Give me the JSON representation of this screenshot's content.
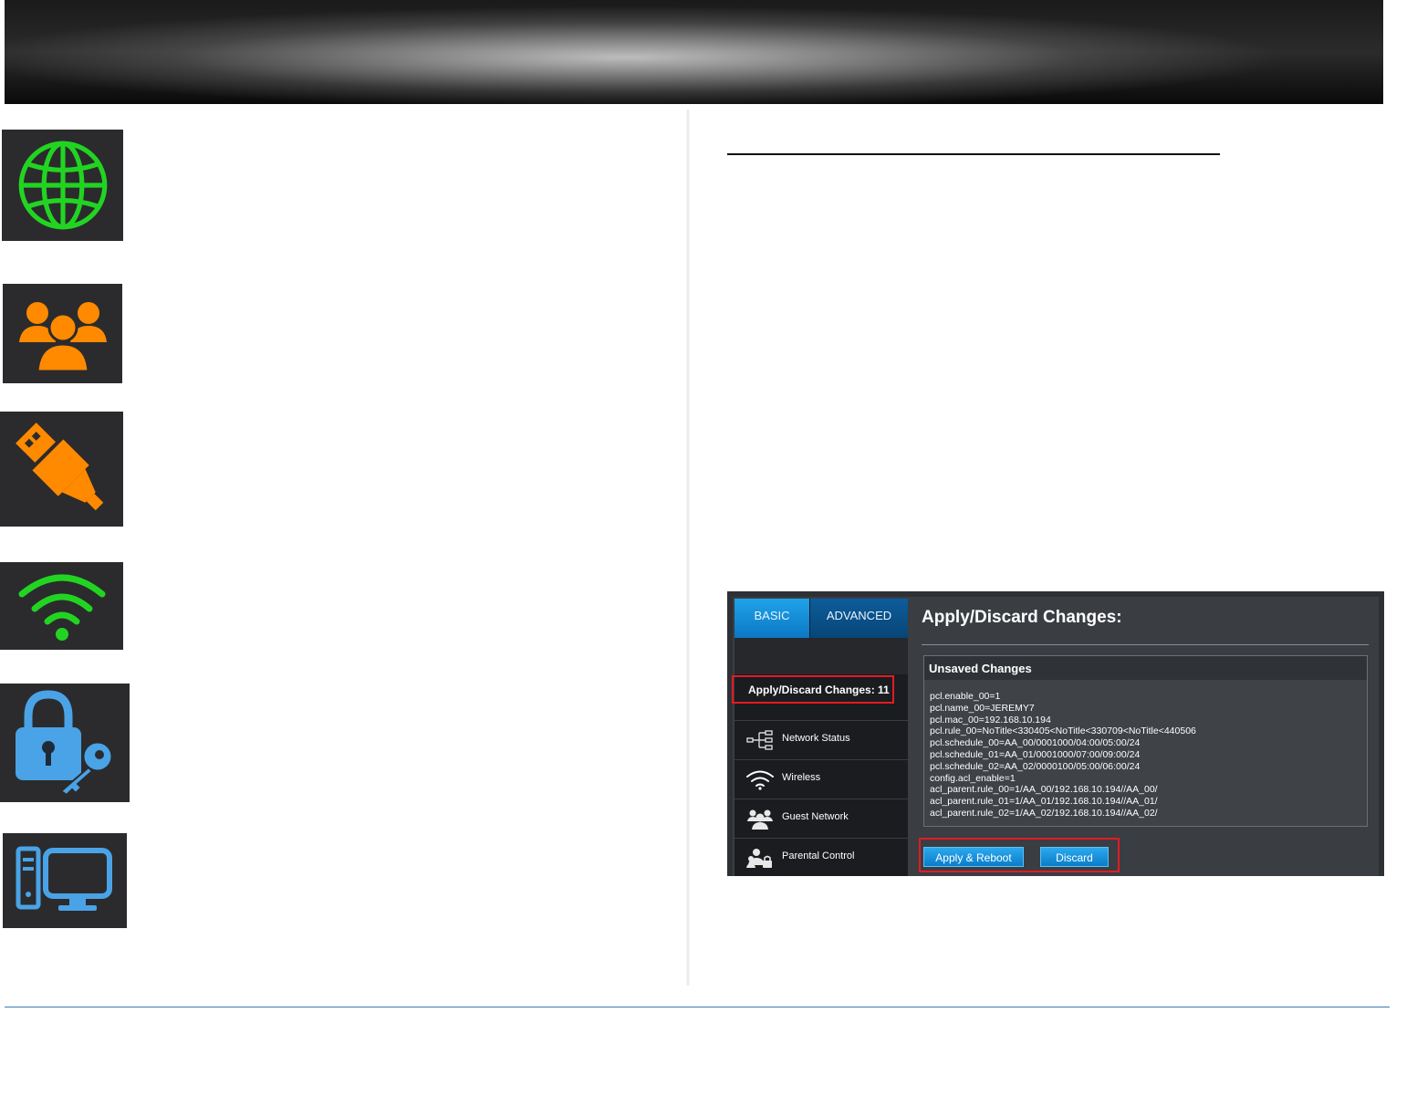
{
  "router_ui": {
    "tabs": {
      "basic": "BASIC",
      "advanced": "ADVANCED"
    },
    "apply_item_label": "Apply/Discard Changes: 11",
    "nav_items": [
      {
        "label": "Network Status",
        "icon": "network-status-icon"
      },
      {
        "label": "Wireless",
        "icon": "wifi-icon"
      },
      {
        "label": "Guest Network",
        "icon": "guest-network-icon"
      },
      {
        "label": "Parental Control",
        "icon": "parental-control-icon"
      }
    ],
    "content_title": "Apply/Discard Changes:",
    "panel_title": "Unsaved Changes",
    "changes": [
      "pcl.enable_00=1",
      "pcl.name_00=JEREMY7",
      "pcl.mac_00=192.168.10.194",
      "pcl.rule_00=NoTitle<330405<NoTitle<330709<NoTitle<440506",
      "pcl.schedule_00=AA_00/0001000/04:00/05:00/24",
      "pcl.schedule_01=AA_01/0001000/07:00/09:00/24",
      "pcl.schedule_02=AA_02/0000100/05:00/06:00/24",
      "config.acl_enable=1",
      "acl_parent.rule_00=1/AA_00/192.168.10.194//AA_00/",
      "acl_parent.rule_01=1/AA_01/192.168.10.194//AA_01/",
      "acl_parent.rule_02=1/AA_02/192.168.10.194//AA_02/"
    ],
    "buttons": {
      "apply": "Apply & Reboot",
      "discard": "Discard"
    }
  },
  "side_icons": [
    "globe-icon",
    "users-icon",
    "usb-icon",
    "wifi-icon",
    "lock-key-icon",
    "computer-icon"
  ],
  "colors": {
    "green_icon": "#22d422",
    "orange_icon": "#ff8a00",
    "blue_icon": "#4aa3e6",
    "highlight_red": "#e31b23",
    "button_blue": "#1a93dc",
    "footer_line": "#3a7ab8"
  }
}
